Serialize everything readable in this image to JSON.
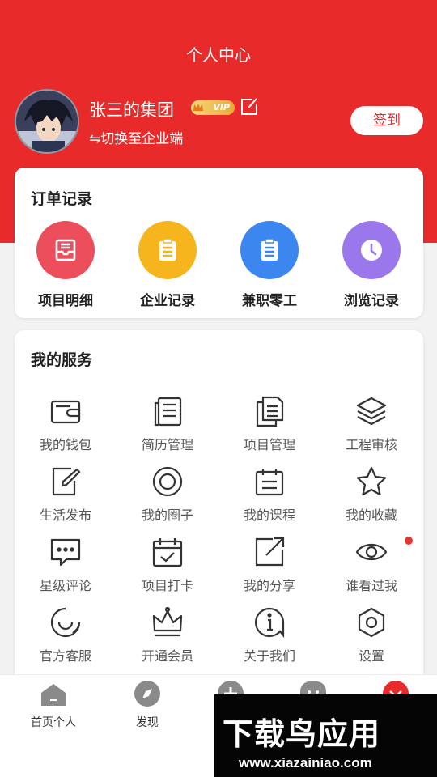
{
  "header": {
    "title": "个人中心"
  },
  "profile": {
    "name": "张三的集团",
    "vip_label": "VIP",
    "switch_text": "⇋切换至企业端",
    "checkin_label": "签到"
  },
  "orders": {
    "title": "订单记录",
    "items": [
      {
        "label": "项目明细",
        "color": "#ec4e5c",
        "icon": "inbox-icon"
      },
      {
        "label": "企业记录",
        "color": "#f6b41d",
        "icon": "clipboard-icon"
      },
      {
        "label": "兼职零工",
        "color": "#3c86f0",
        "icon": "document-icon"
      },
      {
        "label": "浏览记录",
        "color": "#9a78ec",
        "icon": "clock-icon"
      }
    ]
  },
  "services": {
    "title": "我的服务",
    "items": [
      {
        "label": "我的钱包",
        "icon": "wallet-icon"
      },
      {
        "label": "简历管理",
        "icon": "resume-icon"
      },
      {
        "label": "项目管理",
        "icon": "files-icon"
      },
      {
        "label": "工程审核",
        "icon": "layers-icon"
      },
      {
        "label": "生活发布",
        "icon": "pen-icon"
      },
      {
        "label": "我的圈子",
        "icon": "circle-icon"
      },
      {
        "label": "我的课程",
        "icon": "course-icon"
      },
      {
        "label": "我的收藏",
        "icon": "star-icon"
      },
      {
        "label": "星级评论",
        "icon": "comment-icon"
      },
      {
        "label": "项目打卡",
        "icon": "calendar-check-icon"
      },
      {
        "label": "我的分享",
        "icon": "share-icon"
      },
      {
        "label": "谁看过我",
        "icon": "eye-icon"
      },
      {
        "label": "官方客服",
        "icon": "smile-icon"
      },
      {
        "label": "开通会员",
        "icon": "crown-icon"
      },
      {
        "label": "关于我们",
        "icon": "info-icon"
      },
      {
        "label": "设置",
        "icon": "settings-icon"
      }
    ]
  },
  "tabbar": {
    "items": [
      {
        "label": "首页个人",
        "icon": "home-icon"
      },
      {
        "label": "发现",
        "icon": "compass-icon"
      },
      {
        "label": "",
        "icon": "plus-icon"
      },
      {
        "label": "",
        "icon": "message-icon"
      },
      {
        "label": "",
        "icon": "user-icon"
      }
    ]
  },
  "watermark": {
    "name": "下载鸟应用",
    "url": "www.xiazainiao.com"
  },
  "colors": {
    "brand": "#e82a2a"
  }
}
